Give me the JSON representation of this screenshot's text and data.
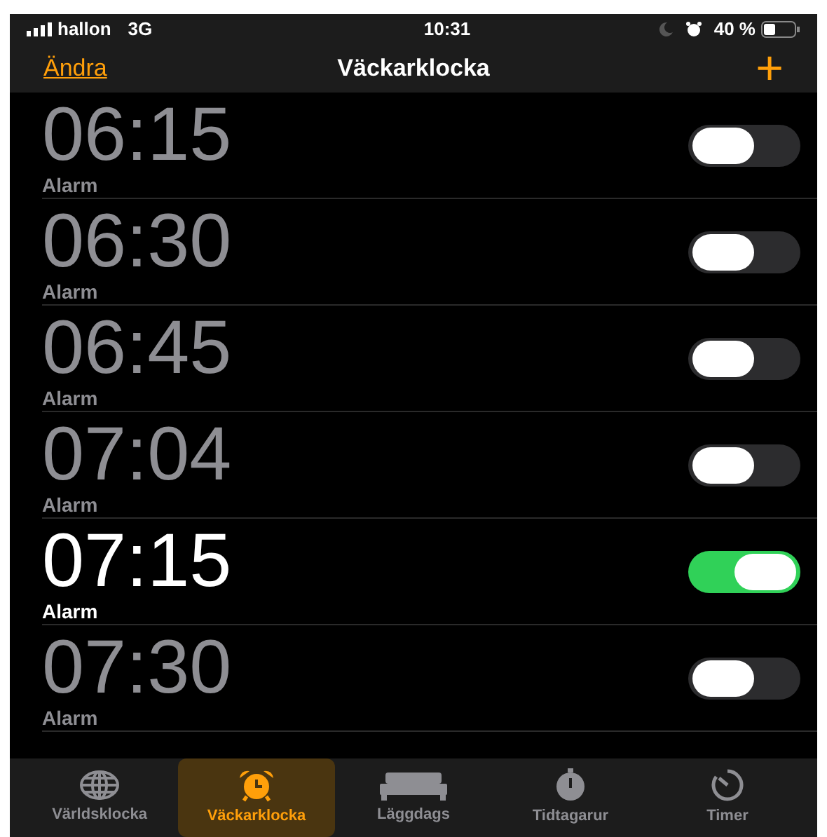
{
  "status_bar": {
    "carrier": "hallon",
    "network": "3G",
    "time": "10:31",
    "battery": "40 %"
  },
  "nav": {
    "edit": "Ändra",
    "title": "Väckarklocka",
    "add": "+"
  },
  "alarms": [
    {
      "time": "06:15",
      "label": "Alarm",
      "on": false
    },
    {
      "time": "06:30",
      "label": "Alarm",
      "on": false
    },
    {
      "time": "06:45",
      "label": "Alarm",
      "on": false
    },
    {
      "time": "07:04",
      "label": "Alarm",
      "on": false
    },
    {
      "time": "07:15",
      "label": "Alarm",
      "on": true
    },
    {
      "time": "07:30",
      "label": "Alarm",
      "on": false
    }
  ],
  "tabs": [
    {
      "label": "Världsklocka",
      "kind": "globe",
      "selected": false
    },
    {
      "label": "Väckarklocka",
      "kind": "alarm",
      "selected": true
    },
    {
      "label": "Läggdags",
      "kind": "bed",
      "selected": false
    },
    {
      "label": "Tidtagarur",
      "kind": "stopwatch",
      "selected": false
    },
    {
      "label": "Timer",
      "kind": "timer",
      "selected": false
    }
  ]
}
